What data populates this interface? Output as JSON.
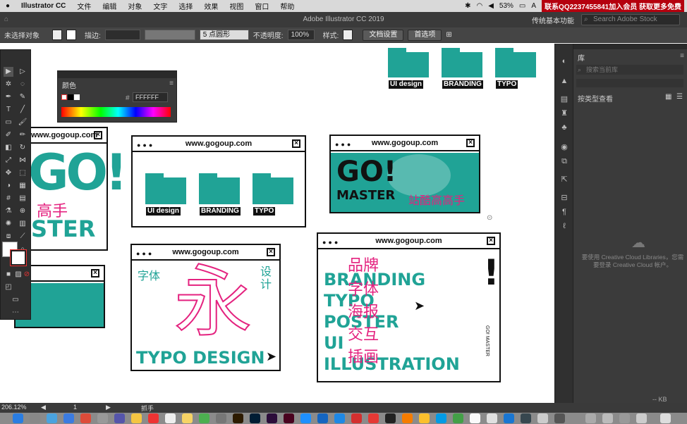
{
  "menubar": {
    "apple": "",
    "app": "Illustrator CC",
    "items": [
      "文件",
      "编辑",
      "对象",
      "文字",
      "选择",
      "效果",
      "视图",
      "窗口",
      "帮助"
    ],
    "battery": "53%",
    "banner": "联系QQ2237455841加入会员 获取更多免费"
  },
  "titlebar": {
    "title": "Adobe Illustrator CC 2019",
    "workspace": "传统基本功能",
    "stock_placeholder": "Search Adobe Stock"
  },
  "control": {
    "no_selection": "未选择对象",
    "stroke_label": "描边:",
    "brush": "5 点圆形",
    "opacity_label": "不透明度:",
    "opacity": "100%",
    "style_label": "样式:",
    "doc_setup": "文档设置",
    "prefs": "首选项"
  },
  "color_panel": {
    "title": "颜色",
    "hex_label": "#",
    "hex": "FFFFFF"
  },
  "library": {
    "tab": "库",
    "search_placeholder": "搜索当前库",
    "view_label": "按类型查看",
    "cc_message": "要使用 Creative Cloud Libraries，您需要登录 Creative Cloud 帐户。",
    "size": "-- KB"
  },
  "status": {
    "zoom": "206.12%",
    "page": "1",
    "tool": "抓手"
  },
  "art": {
    "url": "www.gogoup.com",
    "folders": [
      "UI design",
      "BRANDING",
      "TYPO"
    ],
    "go": "GO!",
    "master": "MASTER",
    "zcool": "站酷高高手",
    "high": "高手",
    "ster": "STER",
    "typo_cn_left": "字体",
    "typo_cn_right": "设计",
    "yong": "永",
    "typo_design": "TYPO DESIGN",
    "brand_en": [
      "BRANDING",
      "TYPO",
      "POSTER",
      "UI",
      "ILLUSTRATION"
    ],
    "brand_cn": [
      "品牌",
      "字体",
      "海报",
      "交互",
      "插画"
    ],
    "bang": "!",
    "side_text": "GO! MASTER"
  },
  "colors": {
    "teal": "#20a396",
    "pink": "#e4227f"
  }
}
